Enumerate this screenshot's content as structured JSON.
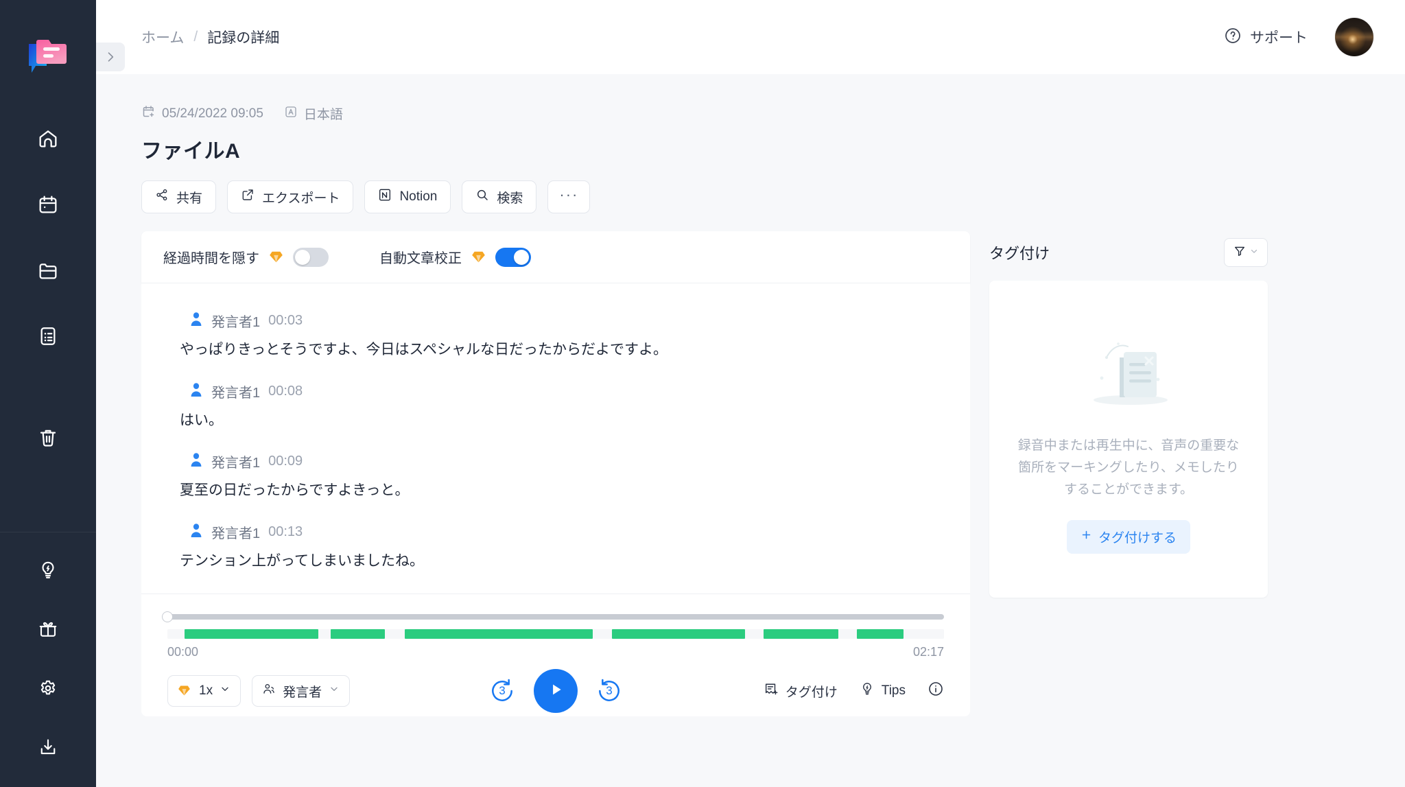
{
  "sidebar": {
    "logo_name": "app-logo",
    "top_items": [
      {
        "icon": "home-icon",
        "name": "sidebar-item-home"
      },
      {
        "icon": "calendar-icon",
        "name": "sidebar-item-calendar"
      },
      {
        "icon": "folder-icon",
        "name": "sidebar-item-folder"
      },
      {
        "icon": "document-list-icon",
        "name": "sidebar-item-records"
      },
      {
        "icon": "trash-icon",
        "name": "sidebar-item-trash"
      }
    ],
    "bottom_items": [
      {
        "icon": "lightbulb-icon",
        "name": "sidebar-item-tips"
      },
      {
        "icon": "gift-icon",
        "name": "sidebar-item-gift"
      },
      {
        "icon": "gear-icon",
        "name": "sidebar-item-settings"
      },
      {
        "icon": "download-icon",
        "name": "sidebar-item-download"
      }
    ],
    "collapse_icon": "chevron-right-icon"
  },
  "topbar": {
    "breadcrumb": {
      "home": "ホーム",
      "separator": "/",
      "current": "記録の詳細"
    },
    "support_label": "サポート",
    "support_icon": "question-circle-icon",
    "avatar_name": "user-avatar"
  },
  "document": {
    "date": "05/24/2022 09:05",
    "date_icon": "calendar-add-icon",
    "language": "日本語",
    "language_icon": "language-icon",
    "title": "ファイルA"
  },
  "actions": [
    {
      "label": "共有",
      "icon": "share-icon",
      "name": "share-button"
    },
    {
      "label": "エクスポート",
      "icon": "export-icon",
      "name": "export-button"
    },
    {
      "label": "Notion",
      "icon": "notion-icon",
      "name": "notion-button"
    },
    {
      "label": "検索",
      "icon": "search-icon",
      "name": "search-button"
    },
    {
      "label": "···",
      "icon": "more-icon",
      "name": "more-button"
    }
  ],
  "toggles": [
    {
      "label": "経過時間を隠す",
      "badge": "premium-gem-icon",
      "on": false,
      "name": "toggle-hide-timestamps"
    },
    {
      "label": "自動文章校正",
      "badge": "premium-gem-icon",
      "on": true,
      "name": "toggle-auto-proofread"
    }
  ],
  "transcript": {
    "speaker_icon": "speaker-person-icon",
    "segments": [
      {
        "speaker": "発言者1",
        "time": "00:03",
        "text": "やっぱりきっとそうですよ、今日はスペシャルな日だったからだよですよ。"
      },
      {
        "speaker": "発言者1",
        "time": "00:08",
        "text": "はい。"
      },
      {
        "speaker": "発言者1",
        "time": "00:09",
        "text": "夏至の日だったからですよきっと。"
      },
      {
        "speaker": "発言者1",
        "time": "00:13",
        "text": "テンション上がってしまいましたね。"
      }
    ]
  },
  "player": {
    "current_time": "00:00",
    "total_time": "02:17",
    "progress_percent": 0,
    "speed": "1x",
    "speed_badge": "premium-gem-icon",
    "speaker_filter_label": "発言者",
    "speaker_filter_icon": "people-icon",
    "rewind_seconds": "3",
    "forward_seconds": "3",
    "play_icon": "play-icon",
    "right_actions": [
      {
        "label": "タグ付け",
        "icon": "tag-add-icon",
        "name": "player-tag-button"
      },
      {
        "label": "Tips",
        "icon": "lightbulb-icon",
        "name": "player-tips-button"
      }
    ],
    "info_icon": "info-circle-icon",
    "waveform_segments": [
      {
        "start": 2.2,
        "width": 17.2
      },
      {
        "start": 21.0,
        "width": 7.0
      },
      {
        "start": 30.6,
        "width": 24.2
      },
      {
        "start": 57.2,
        "width": 17.2
      },
      {
        "start": 76.8,
        "width": 9.6
      },
      {
        "start": 88.8,
        "width": 6.0
      }
    ]
  },
  "tag_panel": {
    "title": "タグ付け",
    "filter_icon": "filter-icon",
    "filter_chevron": "chevron-down-icon",
    "empty_illustration": "document-placeholder-illustration",
    "empty_text": "録音中または再生中に、音声の重要な箇所をマーキングしたり、メモしたりすることができます。",
    "add_button_label": "タグ付けする",
    "add_button_icon": "plus-icon"
  },
  "colors": {
    "sidebar_bg": "#222b3a",
    "accent_blue": "#1677f2",
    "wave_green": "#2bcc7f",
    "premium_orange": "#f5a623",
    "page_bg": "#f7f8fa"
  }
}
